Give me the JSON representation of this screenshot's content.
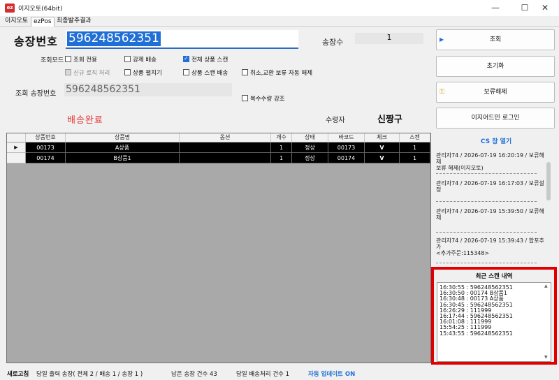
{
  "window": {
    "title": "이지오토(64bit)",
    "app_icon": "ez",
    "minimize": "—",
    "maximize": "☐",
    "close": "✕"
  },
  "menu": {
    "items": [
      "이지오토",
      "ezPos",
      "최종발주결과"
    ],
    "active_index": 1
  },
  "invoice": {
    "label": "송장번호",
    "value": "596248562351",
    "count_label": "송장수",
    "count_value": "1"
  },
  "options": {
    "mode_label": "조회모드",
    "inquiry_only": "조회 전용",
    "force_ship": "강제 배송",
    "full_scan": "전체 상품 스캔",
    "new_logic": "신규 로직 처리",
    "product_split": "상품 펼치기",
    "product_scan_ship": "상품 스캔 배송",
    "cancel_hold": "취소,교환 보류 자동 해제",
    "multi_qty": "복수수량 강조"
  },
  "lookup": {
    "label": "조회 송장번호",
    "value": "596248562351"
  },
  "status_text": "배송완료",
  "receiver": {
    "label": "수령자",
    "value": "신짱구"
  },
  "grid": {
    "columns": [
      "상품번호",
      "상품명",
      "옵션",
      "개수",
      "상태",
      "바코드",
      "체크",
      "스캔"
    ],
    "rows": [
      [
        "00173",
        "A상품",
        "",
        "1",
        "정상",
        "00173",
        "V",
        "1"
      ],
      [
        "00174",
        "B상품1",
        "",
        "1",
        "정상",
        "00174",
        "V",
        "1"
      ]
    ]
  },
  "buttons": {
    "search": "조회",
    "reset": "초기화",
    "release_hold": "보류해제",
    "ezadmin_login": "이지어드민 로그인",
    "cs_open": "CS 창 열기"
  },
  "cs_log": [
    "관리자74 / 2026-07-19 16:20:19 / 보류해제\n보류 해제(이지오토)",
    "관리자74 / 2026-07-19 16:17:03 / 보류설정",
    "관리자74 / 2026-07-19 15:39:50 / 보류해제",
    "관리자74 / 2026-07-19 15:39:43 / 합포추가\n<추가주문:115348>"
  ],
  "recent_scan": {
    "title": "최근 스캔 내역",
    "entries": [
      "16:30:55 : 596248562351",
      "16:30:50 : 00174 B상품1",
      "16:30:48 : 00173 A상품",
      "16:30:45 : 596248562351",
      "16:26:29 : 111999",
      "16:17:44 : 596248562351",
      "16:01:08 : 111999",
      "15:54:25 : 111999",
      "15:43:55 : 596248562351"
    ]
  },
  "statusbar": {
    "refresh": "새로고침",
    "today_print": "당일 출력 송장( 전체 2 / 배송 1 / 송장 1 )",
    "remaining": "남은 송장 건수 43",
    "today_ship": "당일 배송처리 건수 1",
    "auto_update": "자동 업데이트 ON"
  },
  "colors": {
    "selection": "#1f6fd6",
    "status_red": "#e53935",
    "highlight_border": "#e00000",
    "link_blue": "#1f6fd6"
  }
}
